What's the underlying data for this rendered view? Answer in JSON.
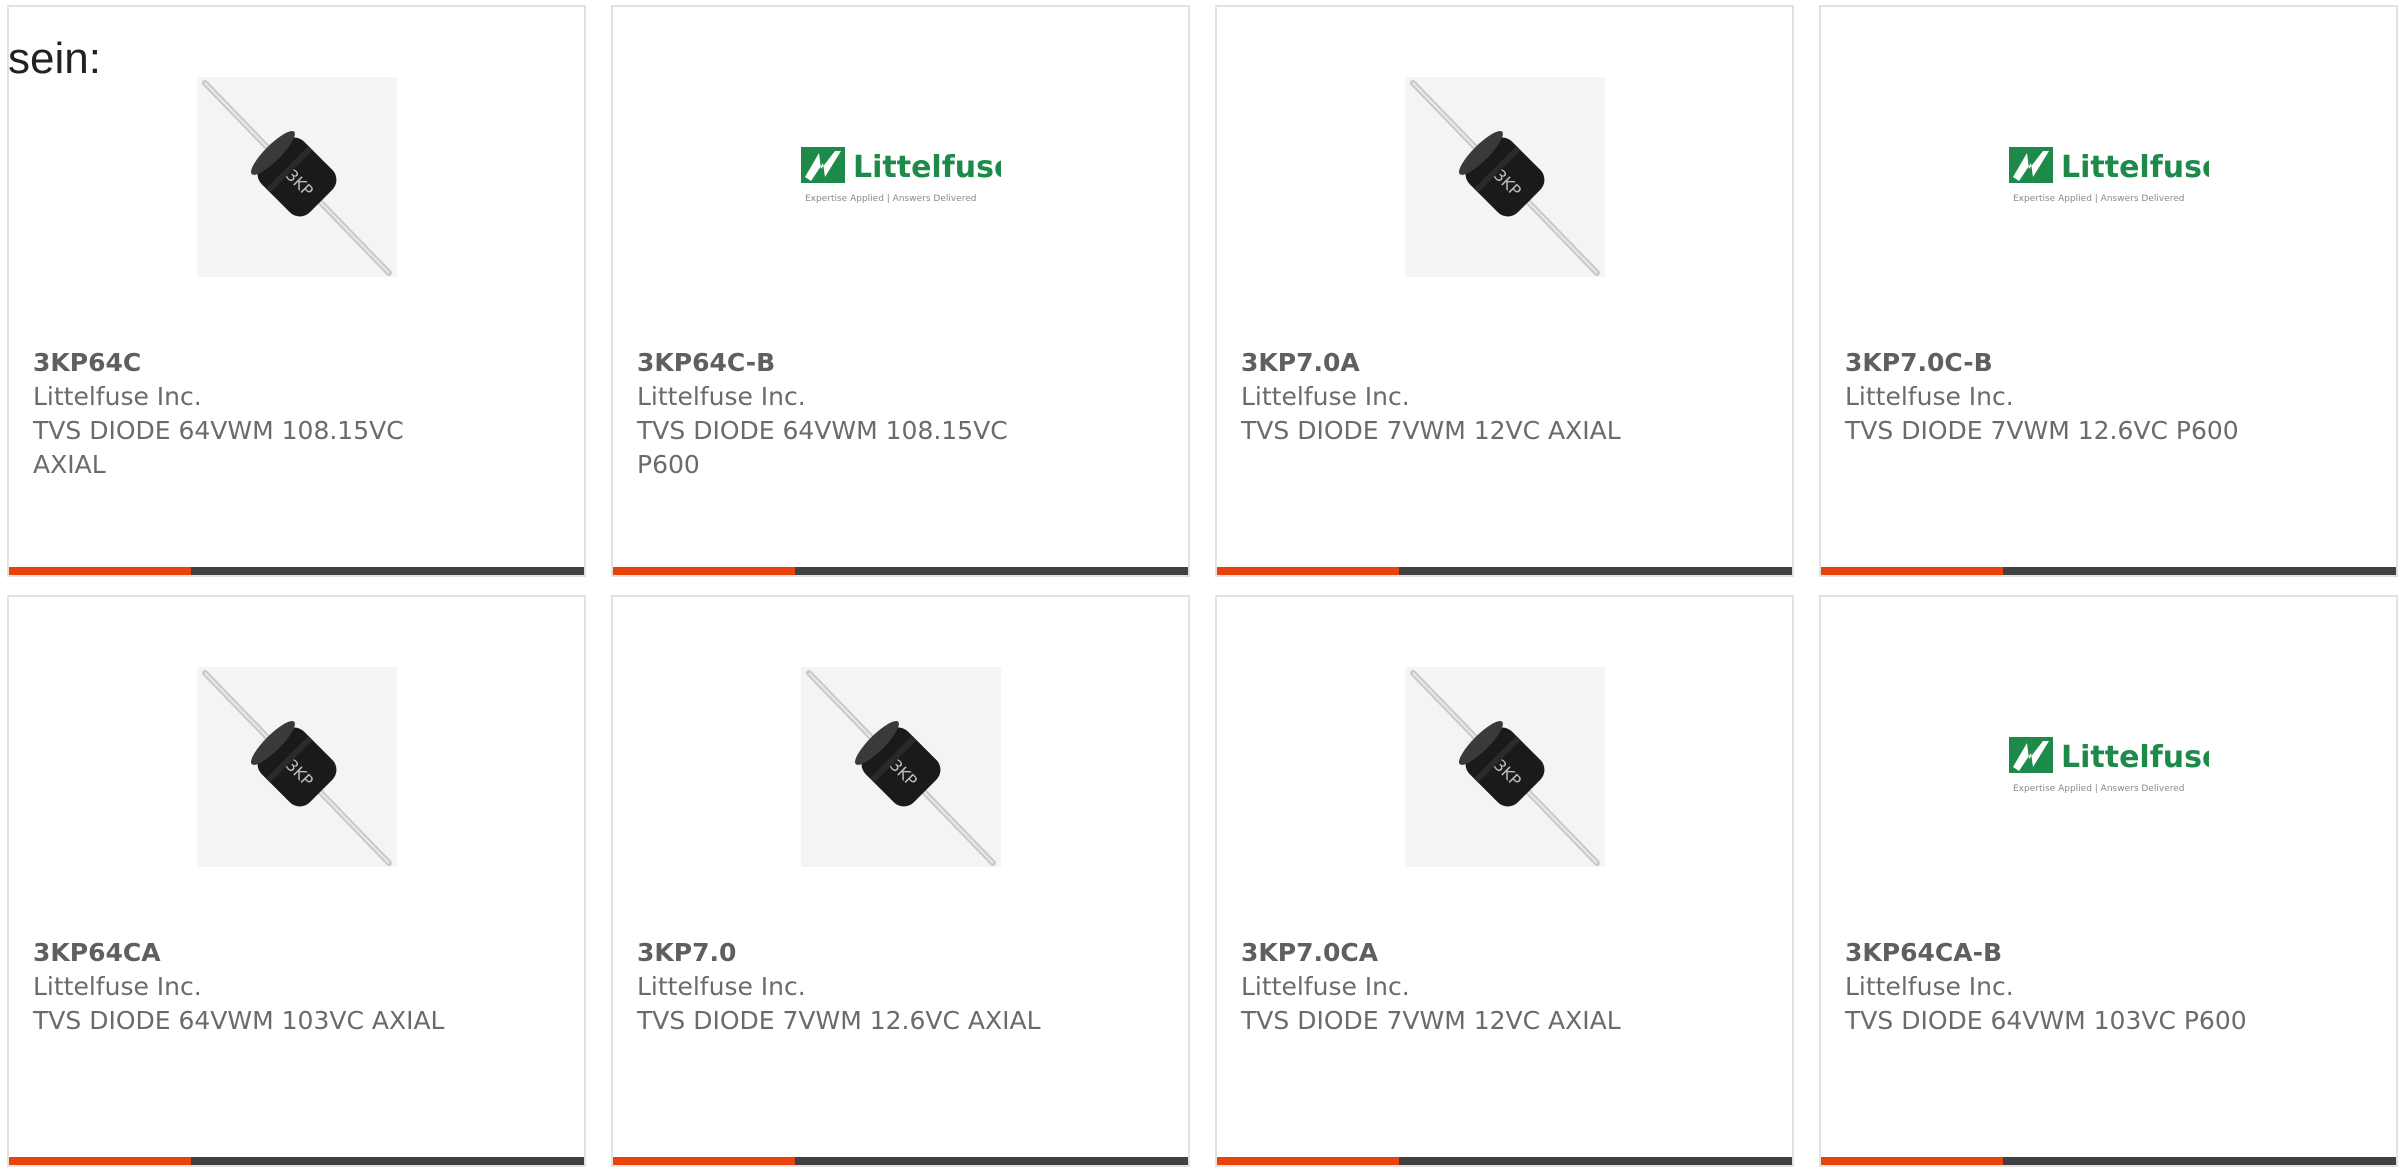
{
  "lead_text": "sein:",
  "colors": {
    "accent": "#e8430c",
    "bar": "#414141",
    "logo_green": "#1e8a4a"
  },
  "cards": [
    {
      "part_number": "3KP64C",
      "manufacturer": "Littelfuse Inc.",
      "description": "TVS DIODE 64VWM 108.15VC AXIAL",
      "image": "diode-photo"
    },
    {
      "part_number": "3KP64C-B",
      "manufacturer": "Littelfuse Inc.",
      "description": "TVS DIODE 64VWM 108.15VC P600",
      "image": "littelfuse-logo"
    },
    {
      "part_number": "3KP7.0A",
      "manufacturer": "Littelfuse Inc.",
      "description": "TVS DIODE 7VWM 12VC AXIAL",
      "image": "diode-photo"
    },
    {
      "part_number": "3KP7.0C-B",
      "manufacturer": "Littelfuse Inc.",
      "description": "TVS DIODE 7VWM 12.6VC P600",
      "image": "littelfuse-logo"
    },
    {
      "part_number": "3KP64CA",
      "manufacturer": "Littelfuse Inc.",
      "description": "TVS DIODE 64VWM 103VC AXIAL",
      "image": "diode-photo"
    },
    {
      "part_number": "3KP7.0",
      "manufacturer": "Littelfuse Inc.",
      "description": "TVS DIODE 7VWM 12.6VC AXIAL",
      "image": "diode-photo"
    },
    {
      "part_number": "3KP7.0CA",
      "manufacturer": "Littelfuse Inc.",
      "description": "TVS DIODE 7VWM 12VC AXIAL",
      "image": "diode-photo"
    },
    {
      "part_number": "3KP64CA-B",
      "manufacturer": "Littelfuse Inc.",
      "description": "TVS DIODE 64VWM 103VC P600",
      "image": "littelfuse-logo"
    }
  ],
  "logo": {
    "brand": "Littelfuse",
    "tagline": "Expertise Applied | Answers Delivered"
  },
  "diode_marking": "3KP"
}
